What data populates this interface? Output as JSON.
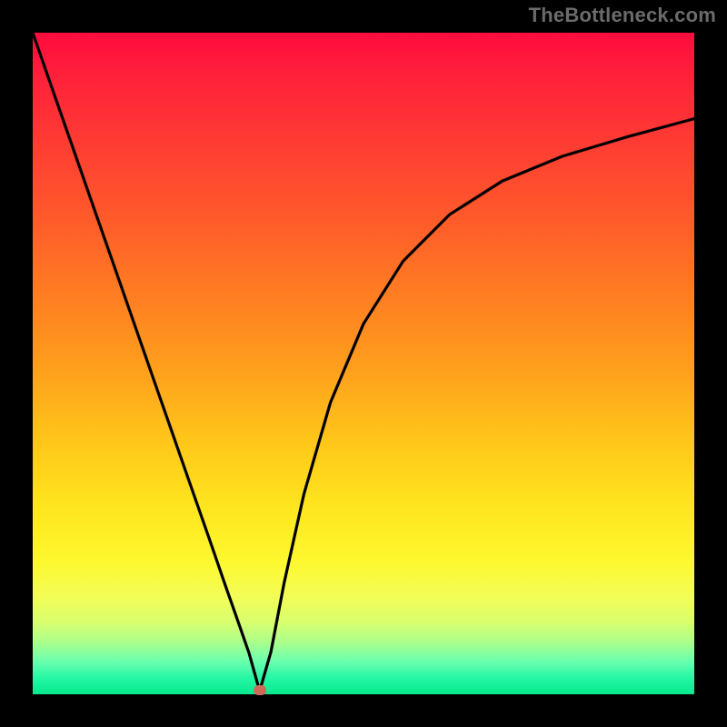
{
  "watermark": "TheBottleneck.com",
  "chart_data": {
    "type": "line",
    "title": "",
    "xlabel": "",
    "ylabel": "",
    "xlim": [
      0,
      100
    ],
    "ylim": [
      0,
      100
    ],
    "grid": false,
    "legend": false,
    "series": [
      {
        "name": "bottleneck-curve",
        "x_percent_of_width": [
          0,
          3,
          6,
          9,
          12,
          15,
          18,
          21,
          24,
          27,
          29,
          31,
          32.7,
          34.3,
          36,
          38,
          41,
          45,
          50,
          56,
          63,
          71,
          80,
          90,
          100
        ],
        "y_percent_of_height_from_bottom": [
          100,
          91.4,
          82.8,
          74.2,
          65.6,
          57.0,
          48.4,
          39.8,
          31.2,
          22.6,
          16.8,
          11.1,
          6.2,
          0.5,
          6.4,
          16.8,
          30.3,
          44.1,
          56.0,
          65.5,
          72.5,
          77.6,
          81.3,
          84.3,
          87.0
        ]
      }
    ],
    "marker": {
      "name": "optimal-point",
      "x_percent_of_width": 34.3,
      "y_percent_of_height_from_bottom": 0.7,
      "color": "#cf6a5a"
    },
    "background_gradient": {
      "top": "#ff0b3f",
      "bottom": "#07e98d",
      "stops": [
        "red",
        "orange",
        "yellow",
        "green"
      ]
    }
  }
}
